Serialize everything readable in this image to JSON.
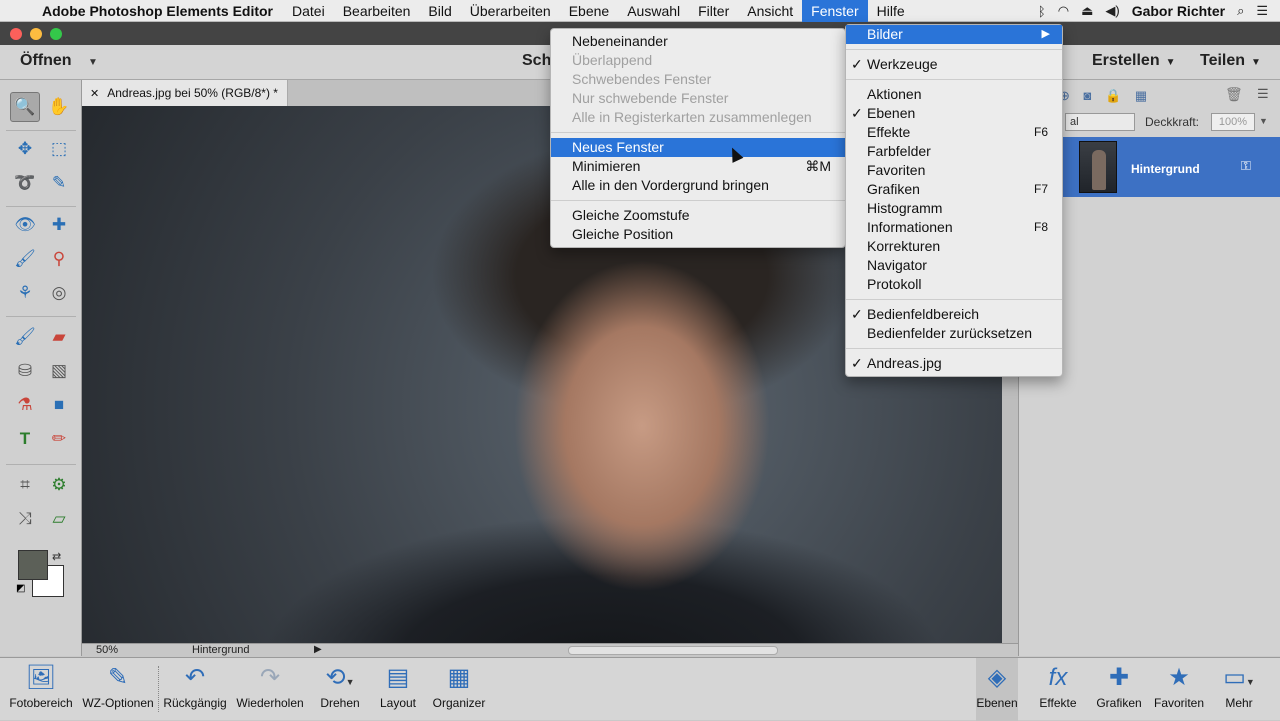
{
  "menubar": {
    "app_name": "Adobe Photoshop Elements Editor",
    "items": [
      "Datei",
      "Bearbeiten",
      "Bild",
      "Überarbeiten",
      "Ebene",
      "Auswahl",
      "Filter",
      "Ansicht",
      "Fenster",
      "Hilfe"
    ],
    "active_item": "Fenster",
    "user": "Gabor Richter"
  },
  "toolbar": {
    "open_label": "Öffnen",
    "mode_label": "Sch",
    "create_label": "Erstellen",
    "share_label": "Teilen"
  },
  "document": {
    "tab_title": "Andreas.jpg bei 50% (RGB/8*) *",
    "zoom": "50%",
    "status_layer": "Hintergrund"
  },
  "layers_panel": {
    "blend_mode": "al",
    "opacity_label": "Deckkraft:",
    "opacity_value": "100%",
    "layer_name": "Hintergrund"
  },
  "fenster_menu": {
    "groups": [
      [
        {
          "label": "Nebeneinander",
          "enabled": true
        },
        {
          "label": "Überlappend",
          "enabled": false
        },
        {
          "label": "Schwebendes Fenster",
          "enabled": false
        },
        {
          "label": "Nur schwebende Fenster",
          "enabled": false
        },
        {
          "label": "Alle in Registerkarten zusammenlegen",
          "enabled": false
        }
      ],
      [
        {
          "label": "Neues Fenster",
          "enabled": true,
          "highlight": true
        },
        {
          "label": "Minimieren",
          "enabled": true,
          "shortcut": "⌘M"
        },
        {
          "label": "Alle in den Vordergrund bringen",
          "enabled": true
        }
      ],
      [
        {
          "label": "Gleiche Zoomstufe",
          "enabled": true
        },
        {
          "label": "Gleiche Position",
          "enabled": true
        }
      ]
    ]
  },
  "submenu": {
    "header": "Bilder",
    "groups": [
      [
        {
          "label": "Werkzeuge",
          "checked": true
        }
      ],
      [
        {
          "label": "Aktionen",
          "checked": false
        },
        {
          "label": "Ebenen",
          "checked": true
        },
        {
          "label": "Effekte",
          "checked": false,
          "shortcut": "F6"
        },
        {
          "label": "Farbfelder",
          "checked": false
        },
        {
          "label": "Favoriten",
          "checked": false
        },
        {
          "label": "Grafiken",
          "checked": false,
          "shortcut": "F7"
        },
        {
          "label": "Histogramm",
          "checked": false
        },
        {
          "label": "Informationen",
          "checked": false,
          "shortcut": "F8"
        },
        {
          "label": "Korrekturen",
          "checked": false
        },
        {
          "label": "Navigator",
          "checked": false
        },
        {
          "label": "Protokoll",
          "checked": false
        }
      ],
      [
        {
          "label": "Bedienfeldbereich",
          "checked": true
        },
        {
          "label": "Bedienfelder zurücksetzen",
          "checked": false
        }
      ],
      [
        {
          "label": "Andreas.jpg",
          "checked": true
        }
      ]
    ]
  },
  "bottombar": {
    "items": [
      {
        "label": "Fotobereich",
        "icon": "photo-bin-icon"
      },
      {
        "label": "WZ-Optionen",
        "icon": "tool-options-icon"
      },
      {
        "label": "Rückgängig",
        "icon": "undo-icon"
      },
      {
        "label": "Wiederholen",
        "icon": "redo-icon"
      },
      {
        "label": "Drehen",
        "icon": "rotate-icon"
      },
      {
        "label": "Layout",
        "icon": "layout-icon"
      },
      {
        "label": "Organizer",
        "icon": "organizer-icon"
      },
      {
        "label": "Ebenen",
        "icon": "layers-icon"
      },
      {
        "label": "Effekte",
        "icon": "fx-icon"
      },
      {
        "label": "Grafiken",
        "icon": "graphics-icon"
      },
      {
        "label": "Favoriten",
        "icon": "star-icon"
      },
      {
        "label": "Mehr",
        "icon": "more-icon"
      }
    ]
  }
}
